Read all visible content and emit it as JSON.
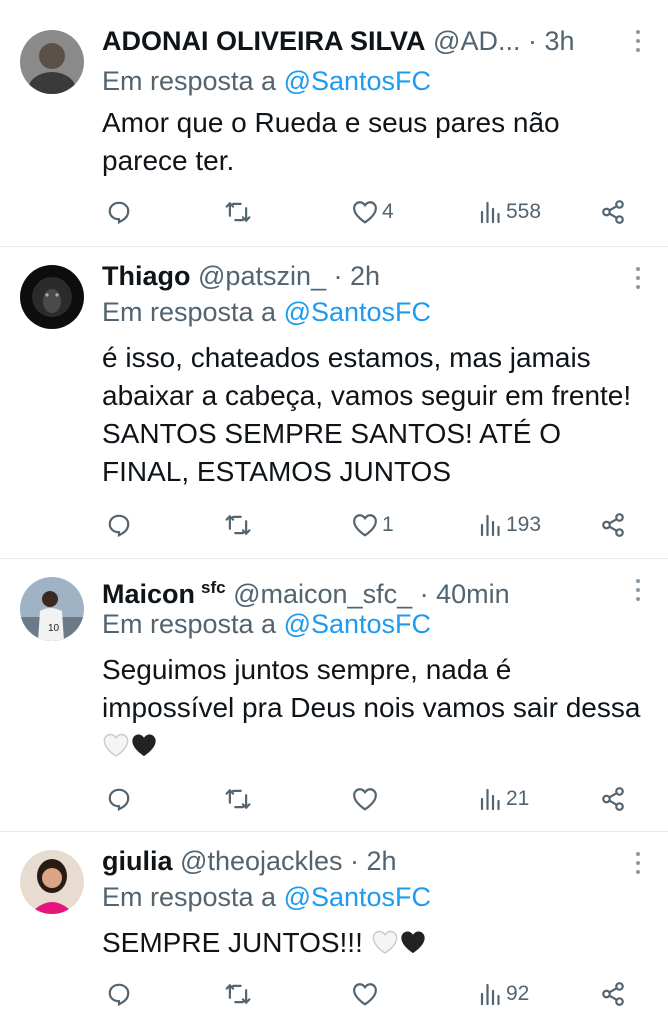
{
  "colors": {
    "text": "#0f1419",
    "secondary": "#536471",
    "link": "#1d9bf0",
    "divider": "#e6e9ec"
  },
  "reply_prefix": "Em resposta a",
  "reply_target": "@SantosFC",
  "tweets": [
    {
      "name": "ADONAI OLIVEIRA SILVA",
      "handle": "@AD...",
      "time": "· 3h",
      "text": "Amor que o Rueda e seus pares não parece ter.",
      "likes": "4",
      "views": "558"
    },
    {
      "name": "Thiago",
      "handle": "@patszin_",
      "time": "· 2h",
      "text": "é isso, chateados estamos, mas jamais abaixar a cabeça, vamos seguir em frente! SANTOS SEMPRE SANTOS! ATÉ O FINAL, ESTAMOS JUNTOS",
      "likes": "1",
      "views": "193"
    },
    {
      "name": "Maicon",
      "name_sup": "sfc",
      "handle": "@maicon_sfc_",
      "time": "· 40min",
      "text": "Seguimos juntos sempre, nada é impossível pra Deus nois vamos sair dessa",
      "likes": "",
      "views": "21"
    },
    {
      "name": "giulia",
      "handle": "@theojackles",
      "time": "· 2h",
      "text": "SEMPRE JUNTOS!!!",
      "likes": "",
      "views": "92"
    }
  ],
  "icons": [
    "reply-icon",
    "retweet-icon",
    "like-icon",
    "views-icon",
    "share-icon",
    "more-icon",
    "white-heart-emoji",
    "black-heart-emoji"
  ]
}
